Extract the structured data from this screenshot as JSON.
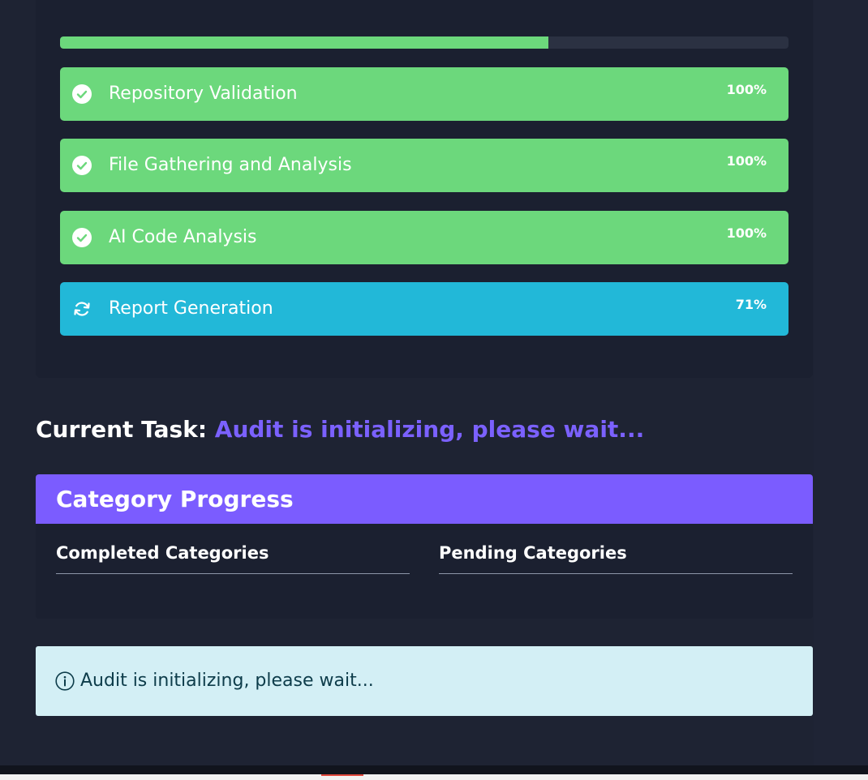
{
  "overall_progress": 0.67,
  "steps": [
    {
      "label": "Repository Validation",
      "percent": "100%",
      "status": "completed",
      "icon": "check-circle-icon"
    },
    {
      "label": "File Gathering and Analysis",
      "percent": "100%",
      "status": "completed",
      "icon": "check-circle-icon"
    },
    {
      "label": "AI Code Analysis",
      "percent": "100%",
      "status": "completed",
      "icon": "check-circle-icon"
    },
    {
      "label": "Report Generation",
      "percent": "71%",
      "status": "in-progress",
      "icon": "sync-icon"
    }
  ],
  "current_task": {
    "label": "Current Task:",
    "value": "Audit is initializing, please wait..."
  },
  "category_progress": {
    "title": "Category Progress",
    "completed_heading": "Completed Categories",
    "pending_heading": "Pending Categories"
  },
  "info": {
    "icon": "info-circle-icon",
    "message": "Audit is initializing, please wait..."
  },
  "colors": {
    "background": "#1e2333",
    "completed": "#6cd87c",
    "in_progress": "#22b8d8",
    "accent": "#7b5cff",
    "info_background": "#d3eff5",
    "info_text": "#0d3c4a"
  }
}
